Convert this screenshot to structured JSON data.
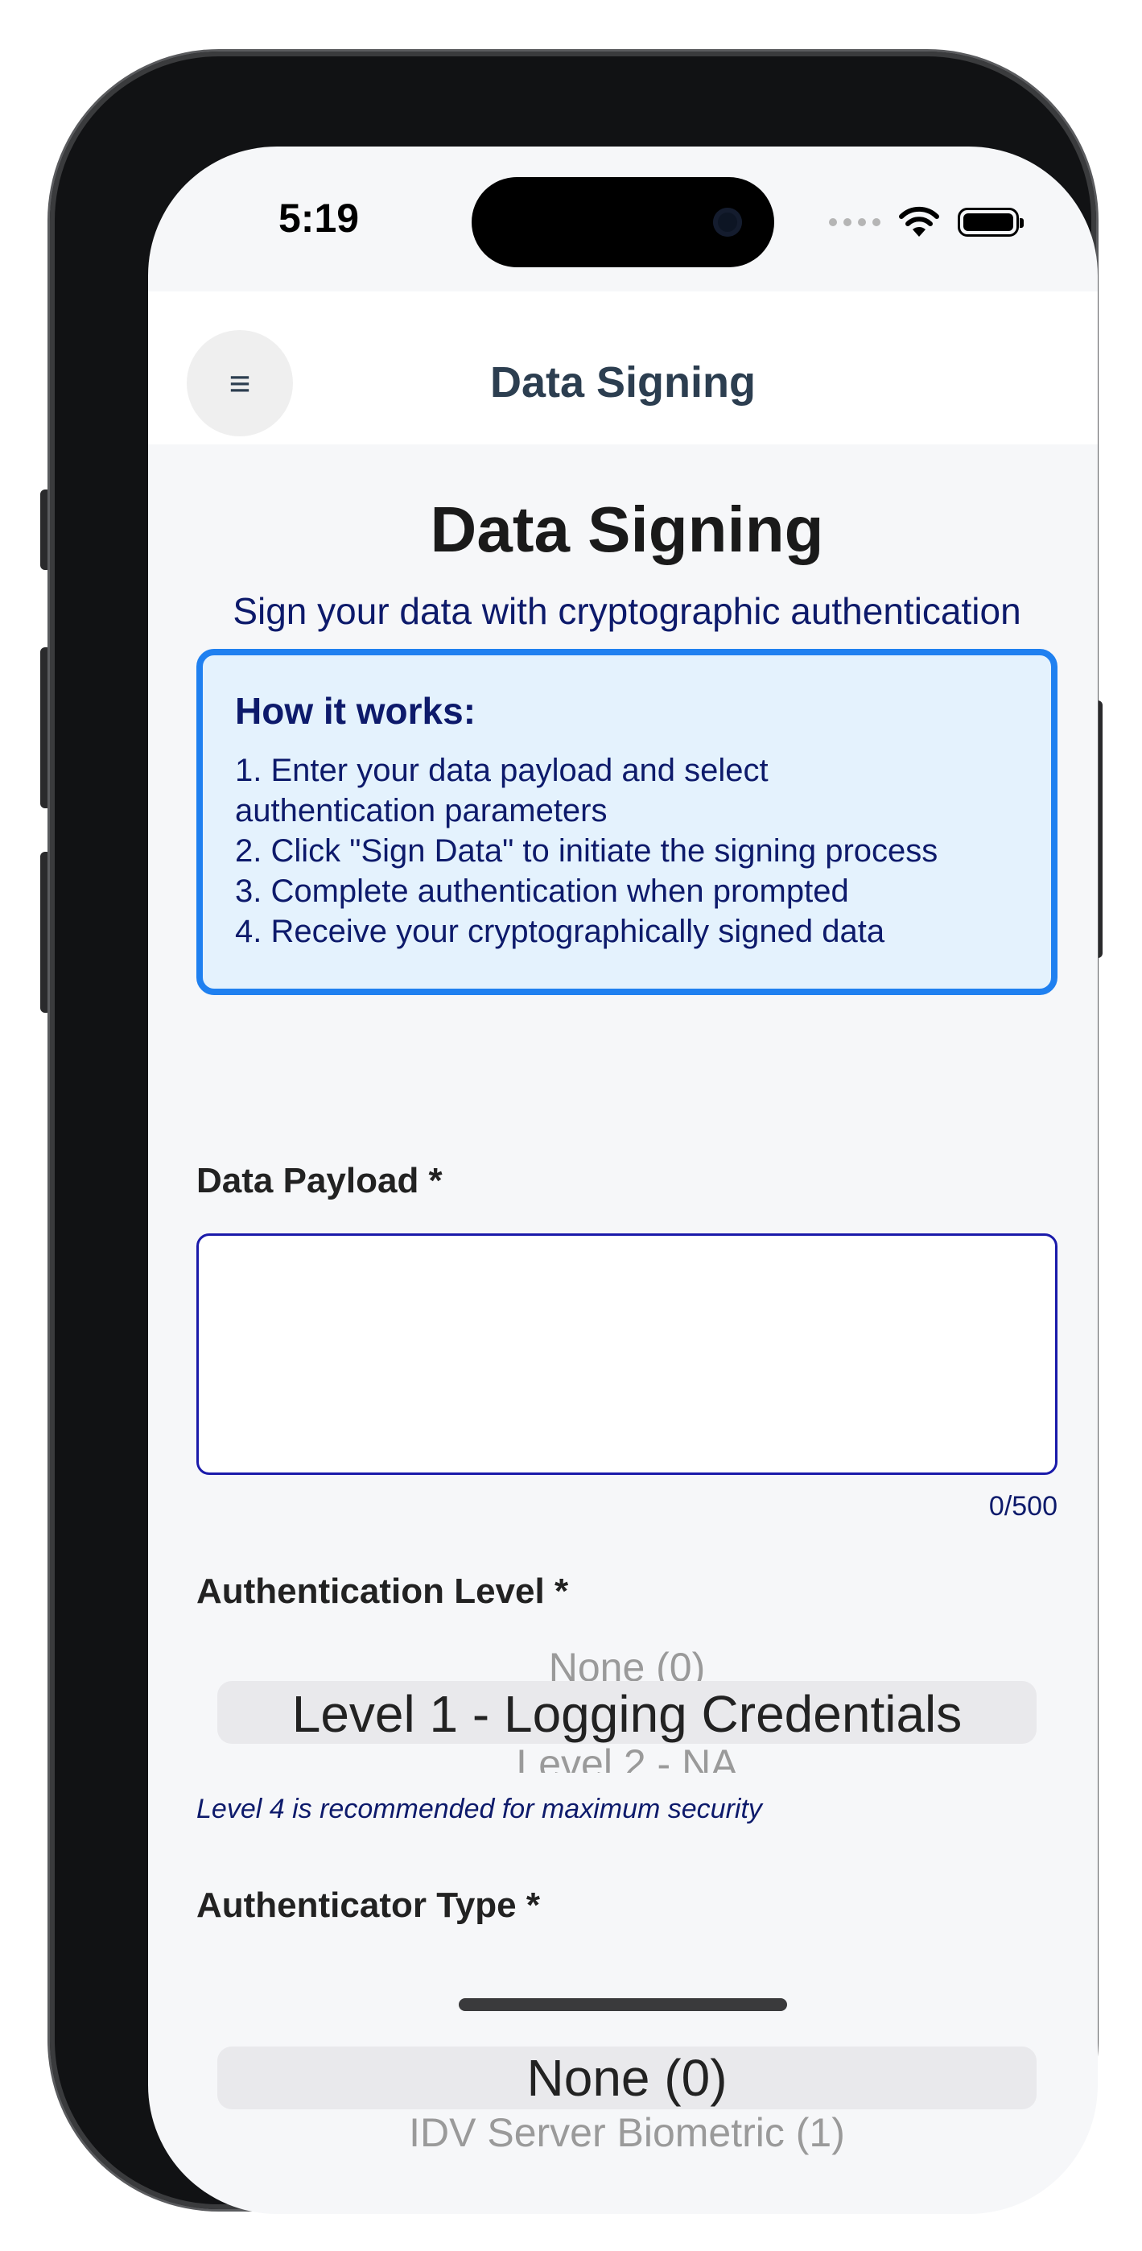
{
  "status_bar": {
    "time": "5:19"
  },
  "header": {
    "title": "Data Signing",
    "menu_icon": "≡"
  },
  "page": {
    "title": "Data Signing",
    "subtitle": "Sign your data with cryptographic authentication"
  },
  "info_box": {
    "heading": "How it works:",
    "steps": [
      "1. Enter your data payload and select",
      "authentication parameters",
      "2. Click \"Sign Data\" to initiate the signing process",
      "3. Complete authentication when prompted",
      "4. Receive your cryptographically signed data"
    ]
  },
  "payload": {
    "label": "Data Payload *",
    "value": "",
    "counter": "0/500"
  },
  "auth_level": {
    "label": "Authentication Level *",
    "options_visible": [
      "None (0)",
      "Level 1 - Logging Credentials",
      "Level 2 - NA"
    ],
    "selected": "Level 1 - Logging Credentials",
    "hint": "Level 4 is recommended for maximum security"
  },
  "authenticator_type": {
    "label": "Authenticator Type *",
    "options_visible": [
      "None (0)",
      "IDV Server Biometric (1)"
    ],
    "selected": "None (0)"
  },
  "colors": {
    "accent_blue": "#1f80f0",
    "info_bg": "#e4f2fd",
    "navy_text": "#0d1a6b",
    "header_text": "#2c3e50"
  }
}
